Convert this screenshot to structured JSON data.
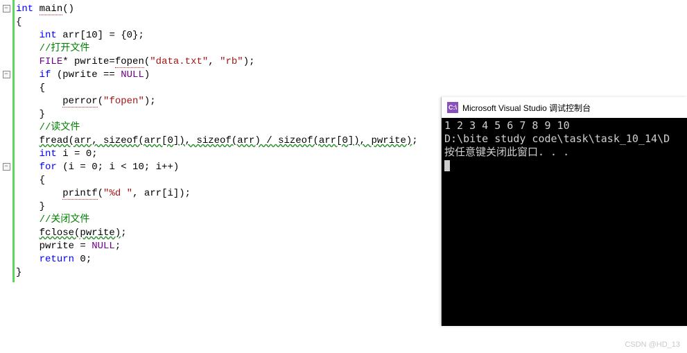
{
  "editor": {
    "lines": [
      {
        "fold": "-",
        "tokens": [
          {
            "t": "int",
            "c": "kw"
          },
          {
            "t": " "
          },
          {
            "t": "main",
            "c": "hl-dot"
          },
          {
            "t": "()"
          }
        ]
      },
      {
        "tokens": [
          {
            "t": "{"
          }
        ]
      },
      {
        "tokens": [
          {
            "t": "    "
          },
          {
            "t": "int",
            "c": "kw"
          },
          {
            "t": " arr[10] = {0};"
          }
        ]
      },
      {
        "tokens": [
          {
            "t": "    "
          },
          {
            "t": "//打开文件",
            "c": "cmt"
          }
        ]
      },
      {
        "tokens": [
          {
            "t": "    "
          },
          {
            "t": "FILE",
            "c": "macro"
          },
          {
            "t": "* pwrite="
          },
          {
            "t": "fopen",
            "c": "hl-dot"
          },
          {
            "t": "("
          },
          {
            "t": "\"data.txt\"",
            "c": "str"
          },
          {
            "t": ", "
          },
          {
            "t": "\"rb\"",
            "c": "str"
          },
          {
            "t": ");"
          }
        ]
      },
      {
        "fold": "-",
        "tokens": [
          {
            "t": "    "
          },
          {
            "t": "if",
            "c": "kw"
          },
          {
            "t": " (pwrite == "
          },
          {
            "t": "NULL",
            "c": "macro"
          },
          {
            "t": ")"
          }
        ]
      },
      {
        "tokens": [
          {
            "t": "    {"
          }
        ]
      },
      {
        "tokens": [
          {
            "t": "        "
          },
          {
            "t": "perror",
            "c": "hl-dot"
          },
          {
            "t": "("
          },
          {
            "t": "\"fopen\"",
            "c": "str"
          },
          {
            "t": ");"
          }
        ]
      },
      {
        "tokens": [
          {
            "t": "    }"
          }
        ]
      },
      {
        "tokens": [
          {
            "t": "    "
          },
          {
            "t": "//读文件",
            "c": "cmt"
          }
        ]
      },
      {
        "tokens": [
          {
            "t": "    "
          },
          {
            "t": "fread(arr, sizeof(arr[0]), sizeof(arr) / sizeof(arr[0]), pwrite)",
            "c": "hl-wave"
          },
          {
            "t": ";"
          }
        ]
      },
      {
        "tokens": [
          {
            "t": "    "
          },
          {
            "t": "int",
            "c": "kw"
          },
          {
            "t": " i = 0;"
          }
        ]
      },
      {
        "fold": "-",
        "tokens": [
          {
            "t": "    "
          },
          {
            "t": "for",
            "c": "kw"
          },
          {
            "t": " (i = 0; i < 10; i++)"
          }
        ]
      },
      {
        "tokens": [
          {
            "t": "    {"
          }
        ]
      },
      {
        "tokens": [
          {
            "t": "        "
          },
          {
            "t": "printf",
            "c": "hl-dot"
          },
          {
            "t": "("
          },
          {
            "t": "\"%d \"",
            "c": "str"
          },
          {
            "t": ", arr[i]);"
          }
        ]
      },
      {
        "tokens": [
          {
            "t": "    }"
          }
        ]
      },
      {
        "tokens": [
          {
            "t": "    "
          },
          {
            "t": "//关闭文件",
            "c": "cmt"
          }
        ]
      },
      {
        "tokens": [
          {
            "t": "    "
          },
          {
            "t": "fclose(pwrite)",
            "c": "hl-wave"
          },
          {
            "t": ";"
          }
        ]
      },
      {
        "tokens": [
          {
            "t": "    pwrite = "
          },
          {
            "t": "NULL",
            "c": "macro"
          },
          {
            "t": ";"
          }
        ]
      },
      {
        "tokens": [
          {
            "t": "    "
          },
          {
            "t": "return",
            "c": "kw"
          },
          {
            "t": " 0;"
          }
        ]
      },
      {
        "tokens": [
          {
            "t": "}"
          }
        ]
      }
    ]
  },
  "console": {
    "iconText": "C:\\",
    "title": "Microsoft Visual Studio 调试控制台",
    "line1": "1 2 3 4 5 6 7 8 9 10",
    "line2": "D:\\bite study code\\task\\task_10_14\\D",
    "line3": "按任意键关闭此窗口. . ."
  },
  "watermark": "CSDN @HD_13"
}
